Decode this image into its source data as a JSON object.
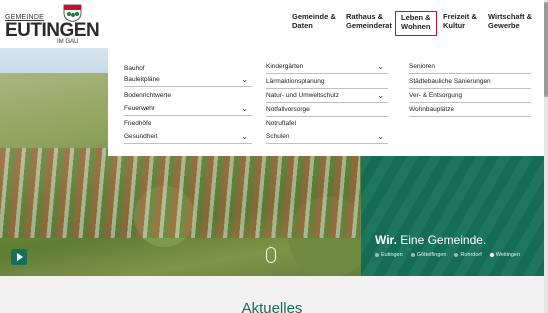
{
  "logo": {
    "top": "GEMEINDE",
    "main": "EUTINGEN",
    "sub": "IM GAU"
  },
  "nav": [
    {
      "l1": "Gemeinde &",
      "l2": "Daten"
    },
    {
      "l1": "Rathaus &",
      "l2": "Gemeinderat"
    },
    {
      "l1": "Leben &",
      "l2": "Wohnen"
    },
    {
      "l1": "Freizeit &",
      "l2": "Kultur"
    },
    {
      "l1": "Wirtschaft &",
      "l2": "Gewerbe"
    }
  ],
  "menu": {
    "col1": [
      "Bauhof",
      "Bauleitpläne",
      "Bodenrichtwerte",
      "Feuerwehr",
      "Friedhöfe",
      "Gesundheit"
    ],
    "col2": [
      "Kindergärten",
      "Lärmaktionsplanung",
      "Natur- und Umweltschutz",
      "Notfallvorsorge",
      "Notrufta­fel",
      "Schulen"
    ],
    "col3": [
      "Senioren",
      "Städtebauliche Sanierungen",
      "Ver- & Entsorgung",
      "Wohnbauplätze"
    ]
  },
  "hero": {
    "slogan_bold": "Wir.",
    "slogan_rest": " Eine Gemeinde.",
    "villages": [
      "Eutingen",
      "Göttelfingen",
      "Rohrdorf",
      "Weitingen"
    ]
  },
  "section_title": "Aktuelles",
  "colors": {
    "brand_green": "#157057",
    "accent_red": "#c8102e"
  }
}
